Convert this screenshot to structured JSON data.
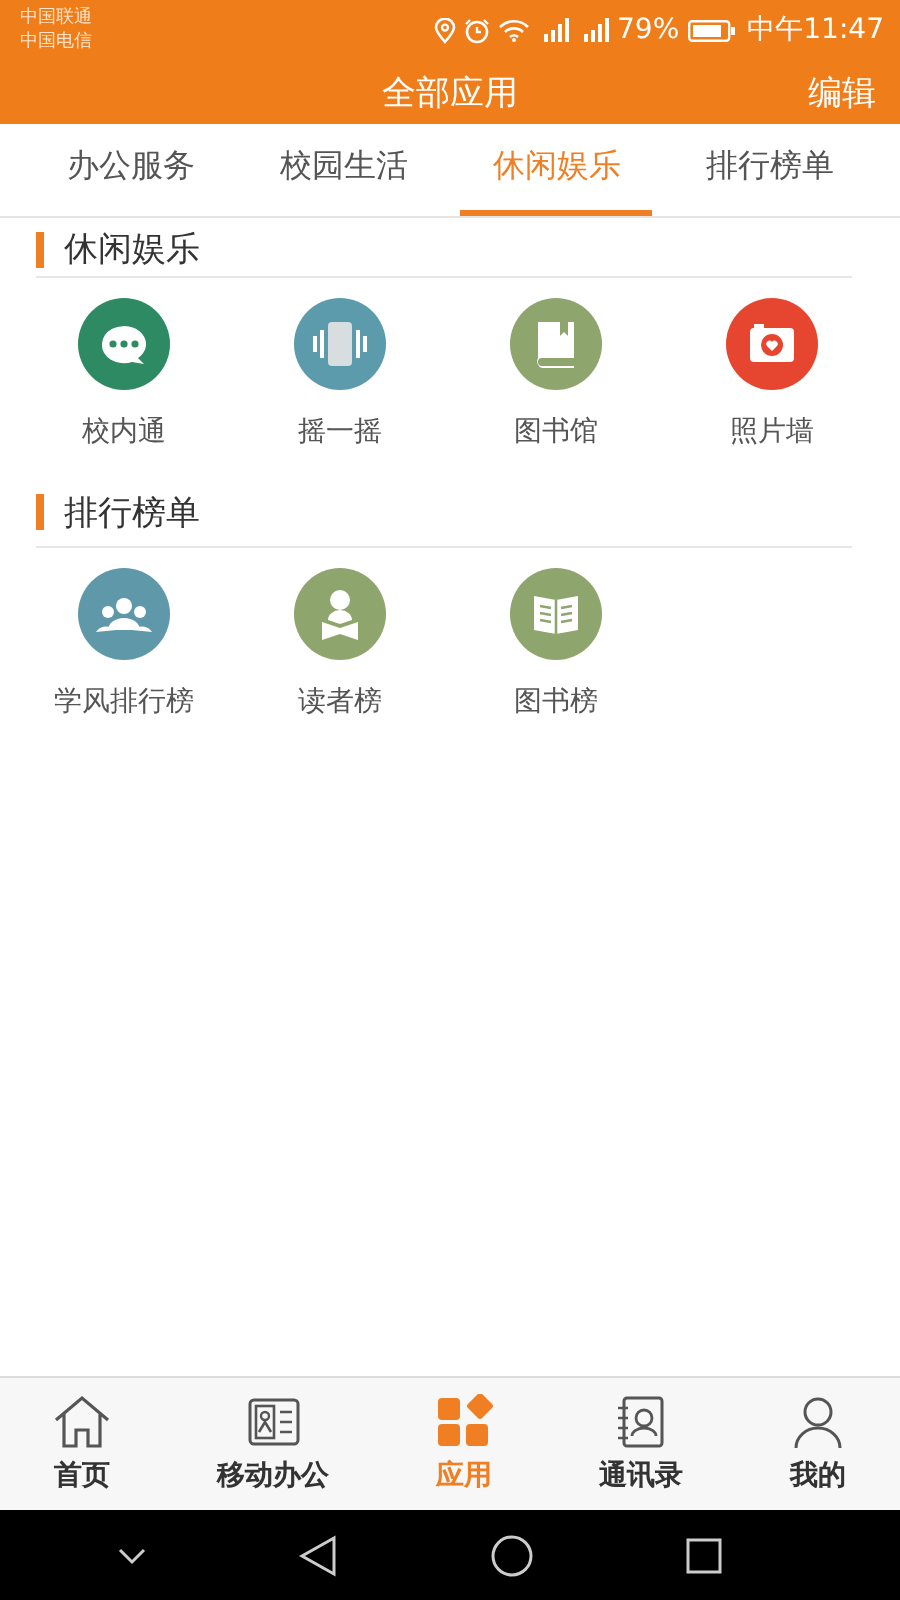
{
  "status_bar": {
    "carriers": [
      "中国联通",
      "中国电信"
    ],
    "battery_text": "79%",
    "time": "中午11:47"
  },
  "header": {
    "title": "全部应用",
    "action": "编辑"
  },
  "tabs": [
    {
      "label": "办公服务",
      "selected": false
    },
    {
      "label": "校园生活",
      "selected": false
    },
    {
      "label": "休闲娱乐",
      "selected": true
    },
    {
      "label": "排行榜单",
      "selected": false
    }
  ],
  "sections": [
    {
      "title": "休闲娱乐",
      "apps": [
        {
          "label": "校内通",
          "kind": "chat",
          "color": "#2e8a62"
        },
        {
          "label": "摇一摇",
          "kind": "shake",
          "color": "#5b9bab"
        },
        {
          "label": "图书馆",
          "kind": "book",
          "color": "#8ea56e"
        },
        {
          "label": "照片墙",
          "kind": "camera",
          "color": "#e6462f"
        }
      ]
    },
    {
      "title": "排行榜单",
      "apps": [
        {
          "label": "学风排行榜",
          "kind": "group",
          "color": "#5e98a9"
        },
        {
          "label": "读者榜",
          "kind": "reader",
          "color": "#8ea56e"
        },
        {
          "label": "图书榜",
          "kind": "openbook",
          "color": "#8ea56e"
        }
      ]
    }
  ],
  "bottom_nav": [
    {
      "label": "首页",
      "kind": "home",
      "selected": false
    },
    {
      "label": "移动办公",
      "kind": "card",
      "selected": false
    },
    {
      "label": "应用",
      "kind": "apps",
      "selected": true
    },
    {
      "label": "通讯录",
      "kind": "contacts",
      "selected": false
    },
    {
      "label": "我的",
      "kind": "person",
      "selected": false
    }
  ]
}
